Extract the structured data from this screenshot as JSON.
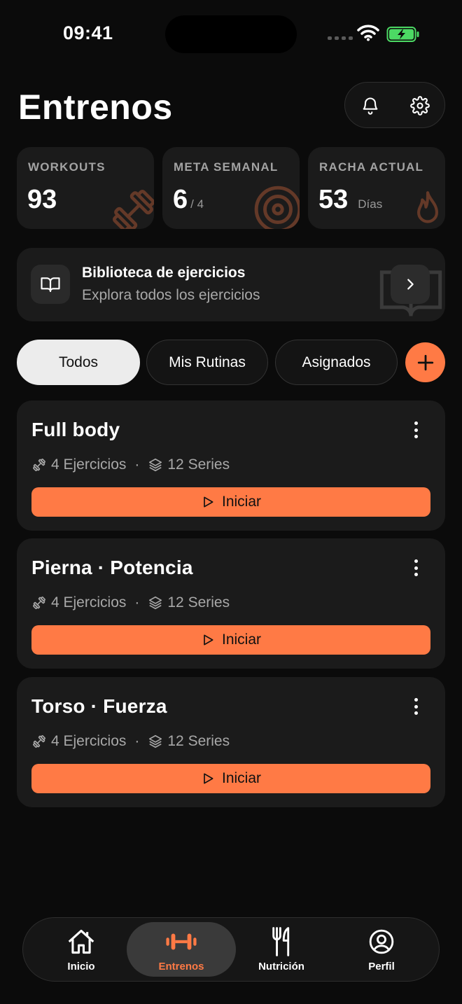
{
  "status_bar": {
    "time": "09:41"
  },
  "header": {
    "title": "Entrenos"
  },
  "stats": [
    {
      "label": "WORKOUTS",
      "value": "93",
      "unit": ""
    },
    {
      "label": "META SEMANAL",
      "value": "6",
      "unit": "/ 4"
    },
    {
      "label": "RACHA ACTUAL",
      "value": "53",
      "unit": "Días"
    }
  ],
  "library": {
    "title": "Biblioteca de ejercicios",
    "subtitle": "Explora todos los ejercicios"
  },
  "filters": [
    {
      "label": "Todos",
      "active": true
    },
    {
      "label": "Mis Rutinas",
      "active": false
    },
    {
      "label": "Asignados",
      "active": false
    }
  ],
  "routines": [
    {
      "title": "Full body",
      "exercises": "4 Ejercicios",
      "series": "12 Series",
      "start_label": "Iniciar"
    },
    {
      "title": "Pierna · Potencia",
      "exercises": "4 Ejercicios",
      "series": "12 Series",
      "start_label": "Iniciar"
    },
    {
      "title": "Torso · Fuerza",
      "exercises": "4 Ejercicios",
      "series": "12 Series",
      "start_label": "Iniciar"
    }
  ],
  "bottom_nav": [
    {
      "label": "Inicio",
      "icon": "home-icon",
      "active": false
    },
    {
      "label": "Entrenos",
      "icon": "dumbbell-icon",
      "active": true
    },
    {
      "label": "Nutrición",
      "icon": "fork-knife-icon",
      "active": false
    },
    {
      "label": "Perfil",
      "icon": "user-circle-icon",
      "active": false
    }
  ],
  "colors": {
    "accent": "#ff7a45",
    "background": "#0b0b0b",
    "card": "#1b1b1b",
    "battery": "#4cd964"
  }
}
